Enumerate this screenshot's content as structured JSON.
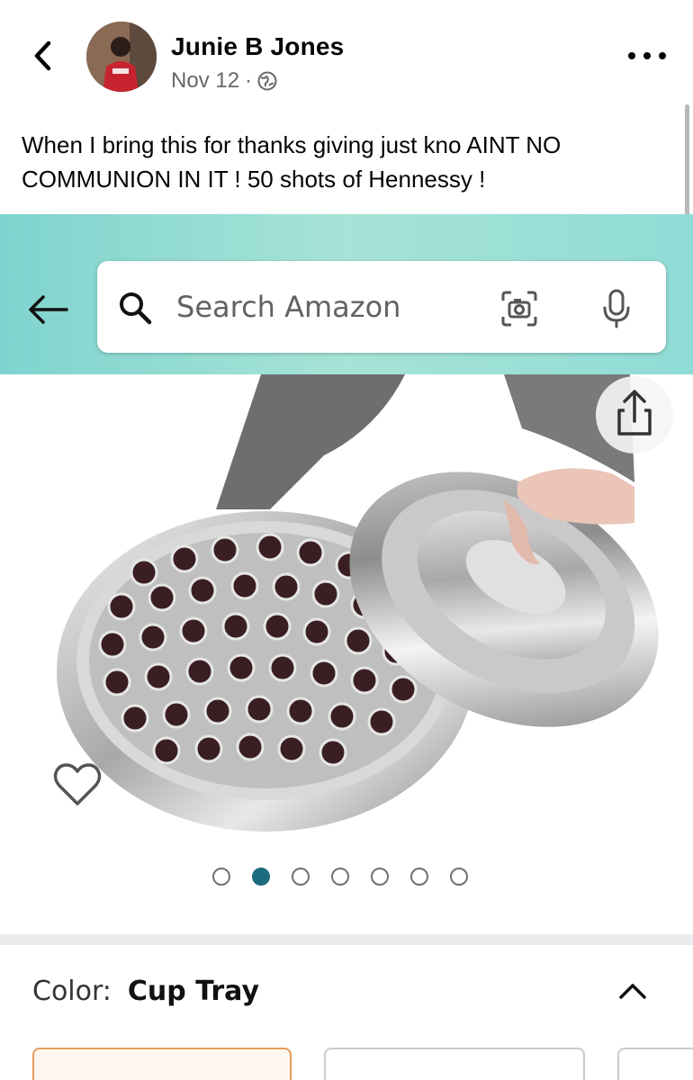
{
  "post": {
    "author_name": "Junie B Jones",
    "date": "Nov 12",
    "separator": "·",
    "audience_icon": "globe-icon",
    "text": "When I bring this for thanks giving just kno AINT NO COMMUNION IN IT ! 50 shots of Hennessy !"
  },
  "amazon": {
    "search_placeholder": "Search Amazon",
    "color_label": "Color:",
    "color_value": "Cup Tray",
    "image_pager": {
      "total": 7,
      "active_index": 1
    },
    "accent_color": "#1c6a7d",
    "topbar_colors": [
      "#7fd4cf",
      "#a7e3d6"
    ]
  }
}
